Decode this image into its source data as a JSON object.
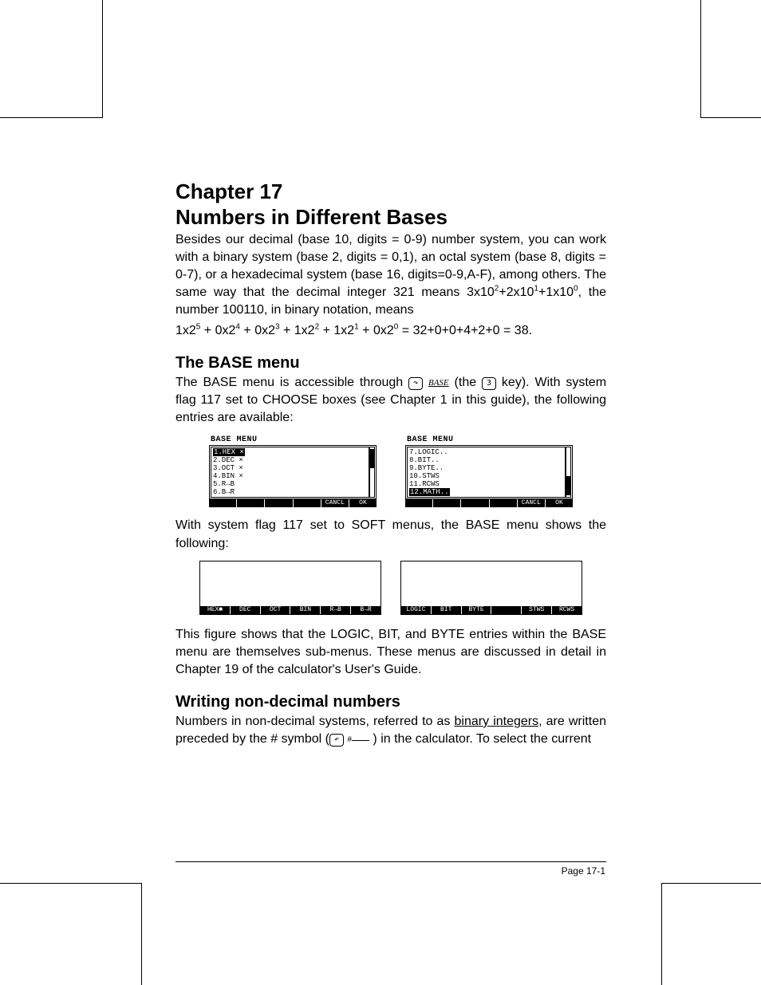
{
  "chapter": {
    "line1": "Chapter 17",
    "line2": "Numbers in Different Bases"
  },
  "intro": {
    "p1a": "Besides our decimal (base 10, digits = 0-9) number system, you can work with a binary system (base 2, digits = 0,1), an octal system (base 8, digits = 0-7), or a hexadecimal system (base 16, digits=0-9,A-F), among others.  The same way that the decimal integer 321 means 3x10",
    "p1b": "+2x10",
    "p1c": "+1x10",
    "p1d": ", the number 100110, in binary notation, means",
    "eq_a": "1x2",
    "eq_b": " + 0x2",
    "eq_c": " + 0x2",
    "eq_d": " + 1x2",
    "eq_e": " + 1x2",
    "eq_f": " + 0x2",
    "eq_tail": " = 32+0+0+4+2+0 = 38.",
    "sup2": "2",
    "sup1": "1",
    "sup0": "0",
    "sup5": "5",
    "sup4": "4",
    "sup3": "3"
  },
  "base_menu": {
    "heading": "The BASE menu",
    "p1a": "The BASE menu is accessible through ",
    "key_shift": "↷",
    "key_base": "BASE",
    "p1b": " (the ",
    "key_3": "3",
    "p1c": " key).   With system flag 117 set to CHOOSE boxes (see Chapter 1 in this guide), the following entries are available:",
    "choose_left": {
      "title": "BASE MENU",
      "items": [
        "1.HEX ×",
        "2.DEC ×",
        "3.OCT ×",
        "4.BIN ×",
        "5.R→B",
        "6.B→R"
      ],
      "softkeys": [
        "",
        "",
        "",
        "",
        "CANCL",
        "OK"
      ],
      "selected_index": 0
    },
    "choose_right": {
      "title": "BASE MENU",
      "items": [
        "7.LOGIC..",
        "8.BIT..",
        "9.BYTE..",
        "10.STWS",
        "11.RCWS",
        "12.MATH.."
      ],
      "softkeys": [
        "",
        "",
        "",
        "",
        "CANCL",
        "OK"
      ],
      "selected_index": 5
    },
    "p2": "With system flag 117 set to SOFT menus, the BASE menu shows the following:",
    "soft_left": [
      "HEX■",
      "DEC",
      "OCT",
      "BIN",
      "R→B",
      "B→R"
    ],
    "soft_right": [
      "LOGIC",
      "BIT",
      "BYTE",
      "",
      "STWS",
      "RCWS"
    ],
    "p3": "This figure shows that the LOGIC, BIT, and BYTE entries within the BASE menu are themselves sub-menus.  These menus are discussed in detail in Chapter 19 of the calculator's User's Guide."
  },
  "writing": {
    "heading": "Writing non-decimal numbers",
    "p1a": "Numbers in non-decimal systems, referred to as ",
    "underlined": "binary integers",
    "p1b": ", are written preceded by the # symbol (",
    "key_shift_left": "↶",
    "key_hash": "#",
    "p1c": " ) in the calculator.  To select the current"
  },
  "footer": {
    "page": "Page 17-1"
  }
}
